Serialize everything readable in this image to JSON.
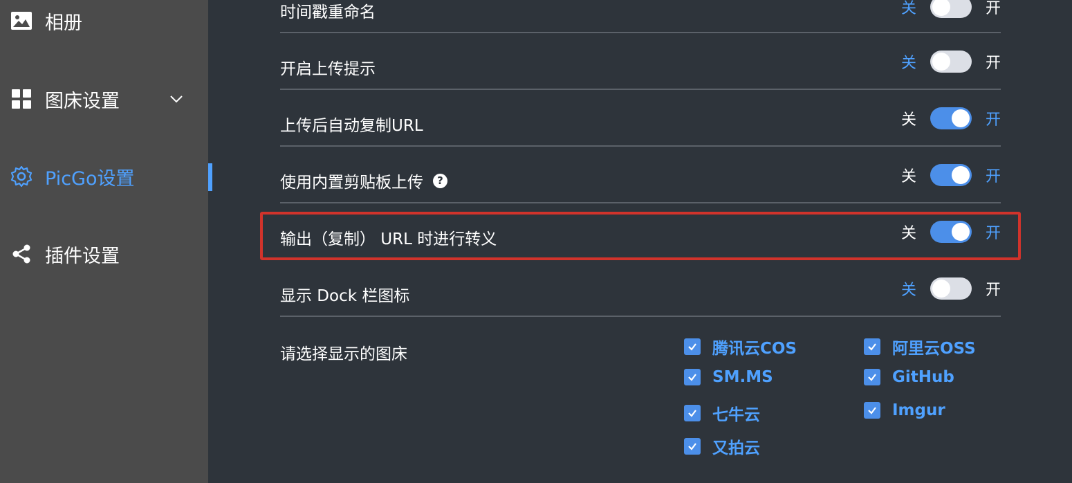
{
  "sidebar": {
    "items": [
      {
        "label": "相册",
        "icon": "image-icon"
      },
      {
        "label": "图床设置",
        "icon": "grid-icon"
      },
      {
        "label": "PicGo设置",
        "icon": "gear-icon"
      },
      {
        "label": "插件设置",
        "icon": "share-icon"
      }
    ]
  },
  "settings": {
    "off_label": "关",
    "on_label": "开",
    "rows": [
      {
        "label": "时间戳重命名",
        "enabled": false
      },
      {
        "label": "开启上传提示",
        "enabled": false
      },
      {
        "label": "上传后自动复制URL",
        "enabled": true
      },
      {
        "label": "使用内置剪贴板上传",
        "enabled": true,
        "help_icon": "?"
      },
      {
        "label": "输出（复制） URL 时进行转义",
        "enabled": true
      },
      {
        "label": "显示 Dock 栏图标",
        "enabled": false
      }
    ],
    "pic_beds": {
      "label": "请选择显示的图床",
      "options": [
        {
          "label": "腾讯云COS",
          "checked": true
        },
        {
          "label": "阿里云OSS",
          "checked": true
        },
        {
          "label": "SM.MS",
          "checked": true
        },
        {
          "label": "GitHub",
          "checked": true
        },
        {
          "label": "七牛云",
          "checked": true
        },
        {
          "label": "Imgur",
          "checked": true
        },
        {
          "label": "又拍云",
          "checked": true
        }
      ]
    }
  },
  "colors": {
    "accent": "#4fa1ff",
    "highlight": "#d1332b",
    "sidebar_bg": "#4b4b4b",
    "main_bg": "#2e343b"
  }
}
